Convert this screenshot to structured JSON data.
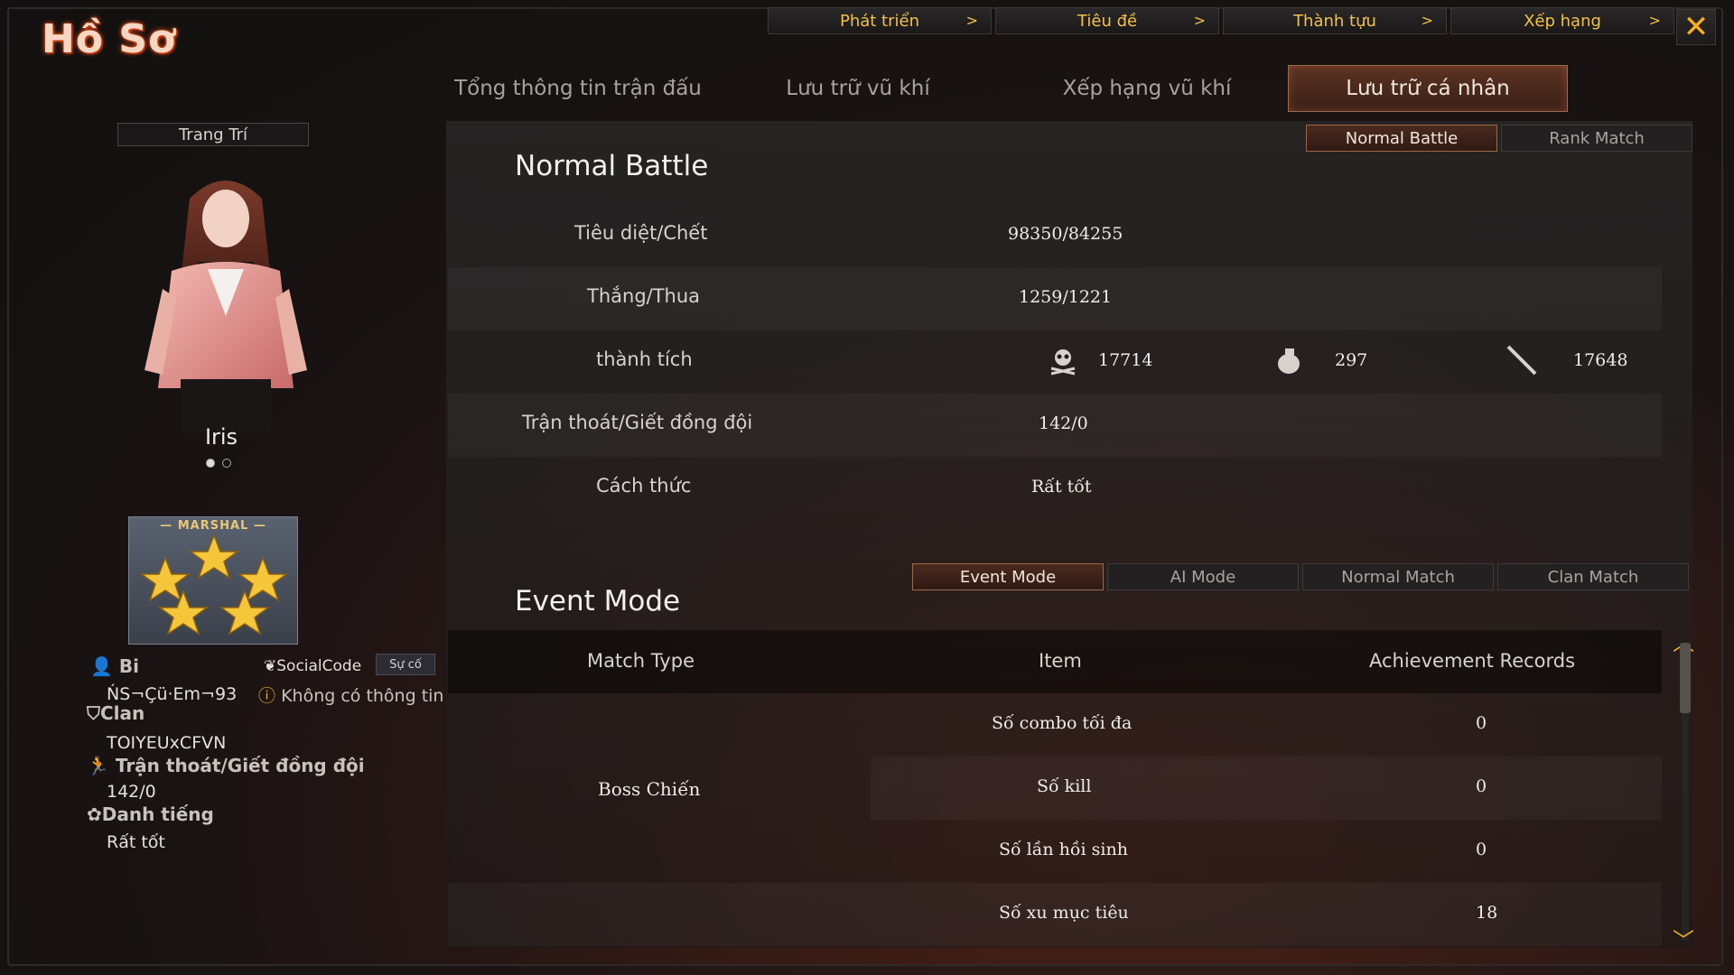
{
  "window": {
    "title": "Hồ Sơ",
    "close_icon": "✕"
  },
  "top_nav": [
    {
      "label": "Phát triển",
      "arrow": ">"
    },
    {
      "label": "Tiêu đề",
      "arrow": ">"
    },
    {
      "label": "Thành tựu",
      "arrow": ">"
    },
    {
      "label": "Xếp hạng",
      "arrow": ">"
    }
  ],
  "main_tabs": [
    {
      "label": "Tổng thông tin trận đấu"
    },
    {
      "label": "Lưu trữ vũ khí"
    },
    {
      "label": "Xếp hạng vũ khí"
    },
    {
      "label": "Lưu trữ cá nhân",
      "active": true
    }
  ],
  "left": {
    "decor_label": "Trang Trí",
    "character_name": "Iris",
    "rank_text": "— MARSHAL —",
    "player": {
      "name_label": "Bi",
      "socialcode_label": "SocialCode",
      "su_co_button": "Sự cố",
      "name_value": "ŃS¬Çü·Em¬93",
      "social_value": "Không có thông tin",
      "clan_label": "Clan",
      "clan_value": "TOIYEUxCFVN",
      "escape_label": "Trận thoát/Giết đồng đội",
      "escape_value": "142/0",
      "reputation_label": "Danh tiếng",
      "reputation_value": "Rất tốt"
    }
  },
  "battle_tabs": [
    {
      "label": "Normal Battle",
      "active": true
    },
    {
      "label": "Rank Match"
    }
  ],
  "normal_battle": {
    "title": "Normal Battle",
    "rows": [
      {
        "label": "Tiêu diệt/Chết",
        "value": "98350/84255"
      },
      {
        "label": "Thắng/Thua",
        "value": "1259/1221"
      },
      {
        "label": "thành tích",
        "headshot": "17714",
        "grenade": "297",
        "knife": "17648"
      },
      {
        "label": "Trận thoát/Giết đồng đội",
        "value": "142/0"
      },
      {
        "label": "Cách thức",
        "value": "Rất tốt"
      }
    ]
  },
  "event_mode": {
    "title": "Event Mode",
    "mode_tabs": [
      {
        "label": "Event Mode",
        "active": true
      },
      {
        "label": "AI Mode"
      },
      {
        "label": "Normal Match"
      },
      {
        "label": "Clan Match"
      }
    ],
    "columns": [
      "Match Type",
      "Item",
      "Achievement Records"
    ],
    "group": "Boss Chiến",
    "rows": [
      {
        "item": "Số combo tối đa",
        "record": "0"
      },
      {
        "item": "Số kill",
        "record": "0"
      },
      {
        "item": "Số lần hồi sinh",
        "record": "0"
      },
      {
        "item": "Số xu mục tiêu",
        "record": "18"
      }
    ]
  },
  "colors": {
    "accent_gold": "#f2c14a",
    "active_tab_border": "#9a6a48",
    "title_glow": "#ff5a1c"
  }
}
